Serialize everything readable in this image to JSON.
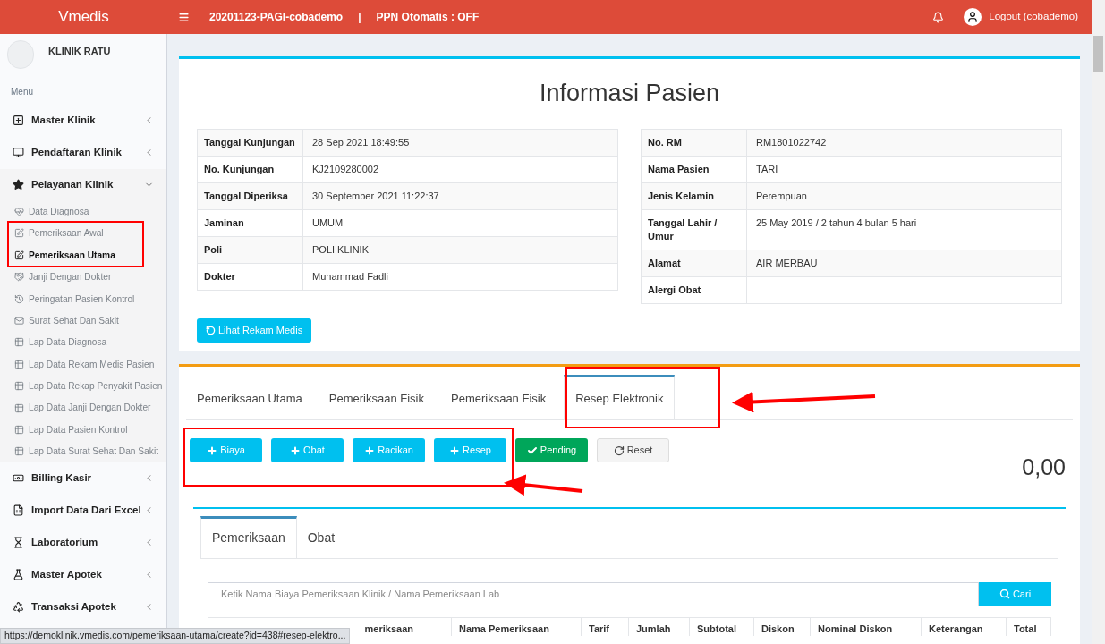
{
  "header": {
    "brand": "Vmedis",
    "session": "20201123-PAGI-cobademo",
    "separator": "|",
    "ppn": "PPN Otomatis : OFF",
    "user": "Logout (cobademo)"
  },
  "sidebar": {
    "clinic": "KLINIK RATU",
    "menu_label": "Menu",
    "items": [
      {
        "label": "Master Klinik",
        "expanded": false
      },
      {
        "label": "Pendaftaran Klinik",
        "expanded": false
      },
      {
        "label": "Pelayanan Klinik",
        "expanded": true,
        "children": [
          {
            "label": "Data Diagnosa",
            "selected": false
          },
          {
            "label": "Pemeriksaan Awal",
            "selected": false
          },
          {
            "label": "Pemeriksaan Utama",
            "selected": true
          },
          {
            "label": "Janji Dengan Dokter",
            "selected": false
          },
          {
            "label": "Peringatan Pasien Kontrol",
            "selected": false
          },
          {
            "label": "Surat Sehat Dan Sakit",
            "selected": false
          },
          {
            "label": "Lap Data Diagnosa",
            "selected": false
          },
          {
            "label": "Lap Data Rekam Medis Pasien",
            "selected": false
          },
          {
            "label": "Lap Data Rekap Penyakit Pasien",
            "selected": false
          },
          {
            "label": "Lap Data Janji Dengan Dokter",
            "selected": false
          },
          {
            "label": "Lap Data Pasien Kontrol",
            "selected": false
          },
          {
            "label": "Lap Data Surat Sehat Dan Sakit",
            "selected": false
          }
        ]
      },
      {
        "label": "Billing Kasir",
        "expanded": false
      },
      {
        "label": "Import Data Dari Excel",
        "expanded": false
      },
      {
        "label": "Laboratorium",
        "expanded": false
      },
      {
        "label": "Master Apotek",
        "expanded": false
      },
      {
        "label": "Transaksi Apotek",
        "expanded": false
      }
    ]
  },
  "patient": {
    "title": "Informasi Pasien",
    "left": [
      {
        "label": "Tanggal Kunjungan",
        "value": "28 Sep 2021 18:49:55"
      },
      {
        "label": "No. Kunjungan",
        "value": "KJ2109280002"
      },
      {
        "label": "Tanggal Diperiksa",
        "value": "30 September 2021 11:22:37"
      },
      {
        "label": "Jaminan",
        "value": "UMUM"
      },
      {
        "label": "Poli",
        "value": "POLI KLINIK"
      },
      {
        "label": "Dokter",
        "value": "Muhammad Fadli"
      }
    ],
    "right": [
      {
        "label": "No. RM",
        "value": "RM1801022742"
      },
      {
        "label": "Nama Pasien",
        "value": "TARI"
      },
      {
        "label": "Jenis Kelamin",
        "value": "Perempuan"
      },
      {
        "label": "Tanggal Lahir / Umur",
        "value": "25 May 2019 / 2 tahun 4 bulan 5 hari"
      },
      {
        "label": "Alamat",
        "value": "AIR MERBAU"
      },
      {
        "label": "Alergi Obat"
      }
    ],
    "button": "Lihat Rekam Medis"
  },
  "exam": {
    "tabs": [
      {
        "label": "Pemeriksaan Utama",
        "selected": false
      },
      {
        "label": "Pemeriksaan Fisik",
        "selected": false
      },
      {
        "label": "Pemeriksaan Fisik",
        "selected": false
      },
      {
        "label": "Resep Elektronik",
        "selected": true
      }
    ],
    "actions": [
      {
        "label": "Biaya",
        "kind": "add"
      },
      {
        "label": "Obat",
        "kind": "add"
      },
      {
        "label": "Racikan",
        "kind": "add"
      },
      {
        "label": "Resep",
        "kind": "add"
      },
      {
        "label": "Pending",
        "kind": "pending"
      },
      {
        "label": "Reset",
        "kind": "reset"
      }
    ],
    "total": "0,00",
    "inner_tabs": [
      {
        "label": "Pemeriksaan",
        "selected": true
      },
      {
        "label": "Obat",
        "selected": false
      }
    ],
    "search": {
      "placeholder": "Ketik Nama Biaya Pemeriksaan Klinik / Nama Pemeriksaan Lab",
      "button": "Cari"
    },
    "table": {
      "columns": [
        "meriksaan",
        "Nama Pemeriksaan",
        "Tarif",
        "Jumlah",
        "Subtotal",
        "Diskon",
        "Nominal Diskon",
        "Keterangan",
        "Total"
      ]
    }
  },
  "status_bar": "https://demoklinik.vmedis.com/pemeriksaan-utama/create?id=438#resep-elektro..."
}
